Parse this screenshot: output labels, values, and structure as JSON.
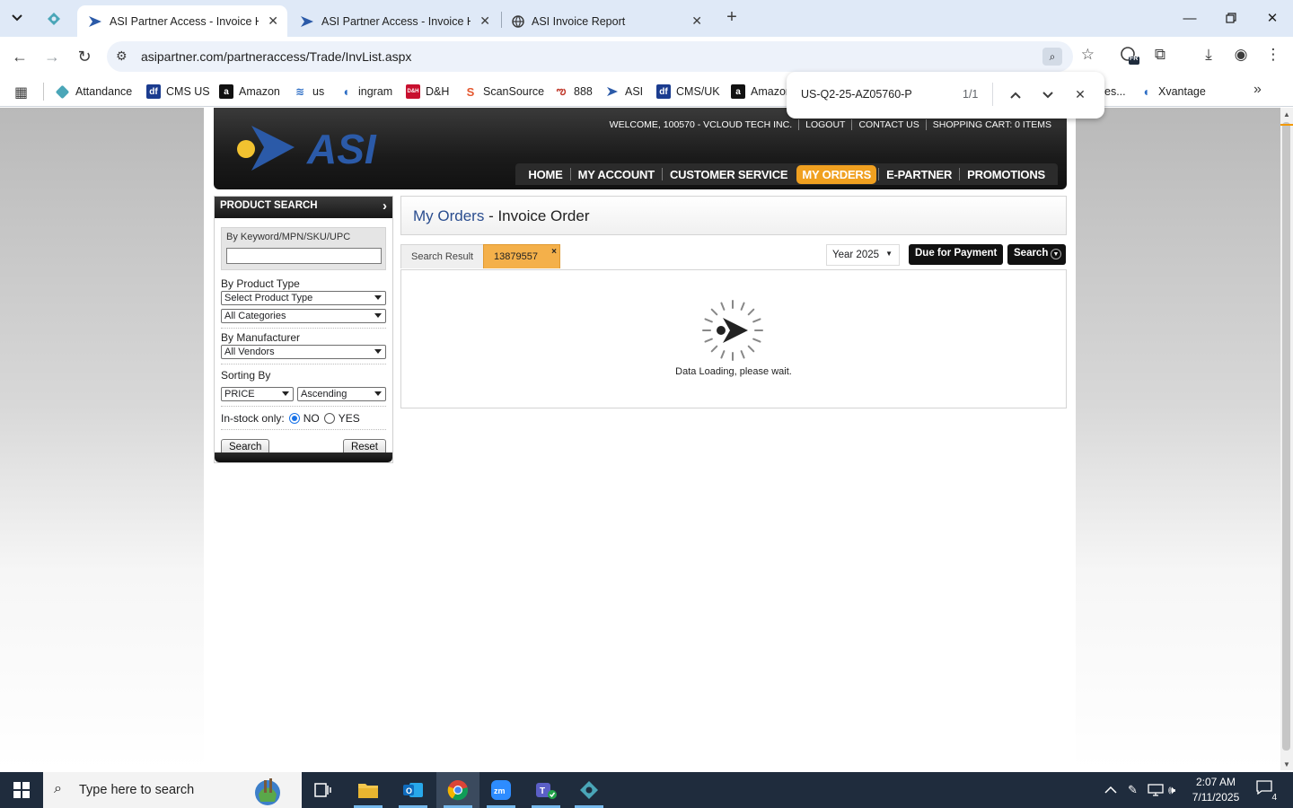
{
  "browser": {
    "tabs": [
      {
        "title": "ASI Partner Access - Invoice His",
        "active": true
      },
      {
        "title": "ASI Partner Access - Invoice His",
        "active": false
      },
      {
        "title": "ASI Invoice Report",
        "active": false
      }
    ],
    "new_tab_label": "+",
    "url": "asipartner.com/partneraccess/Trade/InvList.aspx",
    "bookmarks": [
      "Attandance",
      "CMS US",
      "Amazon",
      "us",
      "ingram",
      "D&H",
      "ScanSource",
      "888",
      "ASI",
      "CMS/UK",
      "Amazon",
      "es...",
      "Xvantage"
    ],
    "find": {
      "query": "US-Q2-25-AZ05760-P",
      "count": "1/1"
    },
    "extension_badge": "FR"
  },
  "site": {
    "logo_text": "ASI",
    "util_links": [
      "WELCOME, 100570 - VCLOUD TECH INC.",
      "LOGOUT",
      "CONTACT US",
      "SHOPPING CART: 0 ITEMS"
    ],
    "nav": [
      "HOME",
      "MY ACCOUNT",
      "CUSTOMER SERVICE",
      "MY ORDERS",
      "E-PARTNER",
      "PROMOTIONS"
    ],
    "nav_active": "MY ORDERS",
    "accent_color": "#f0a020"
  },
  "search_panel": {
    "header": "PRODUCT SEARCH",
    "keyword_label": "By Keyword/MPN/SKU/UPC",
    "keyword_value": "",
    "product_type_label": "By Product Type",
    "product_type_value": "Select Product Type",
    "categories_value": "All Categories",
    "manufacturer_label": "By Manufacturer",
    "manufacturer_value": "All Vendors",
    "sorting_label": "Sorting By",
    "sort_field": "PRICE",
    "sort_order": "Ascending",
    "instock_label": "In-stock only:",
    "instock_no": "NO",
    "instock_yes": "YES",
    "instock_selected": "NO",
    "search_button": "Search",
    "reset_button": "Reset"
  },
  "main": {
    "breadcrumb_link": "My Orders",
    "breadcrumb_sep": " - ",
    "title": "Invoice Order",
    "tabs": [
      {
        "label": "Search Result",
        "active": false
      },
      {
        "label": "13879557",
        "active": true,
        "close": "×"
      }
    ],
    "year_select": "Year 2025",
    "due_button": "Due for Payment",
    "search_button": "Search",
    "loading_text": "Data Loading, please wait."
  },
  "taskbar": {
    "search_placeholder": "Type here to search",
    "time": "2:07 AM",
    "date": "7/11/2025",
    "notification_count": "4"
  }
}
